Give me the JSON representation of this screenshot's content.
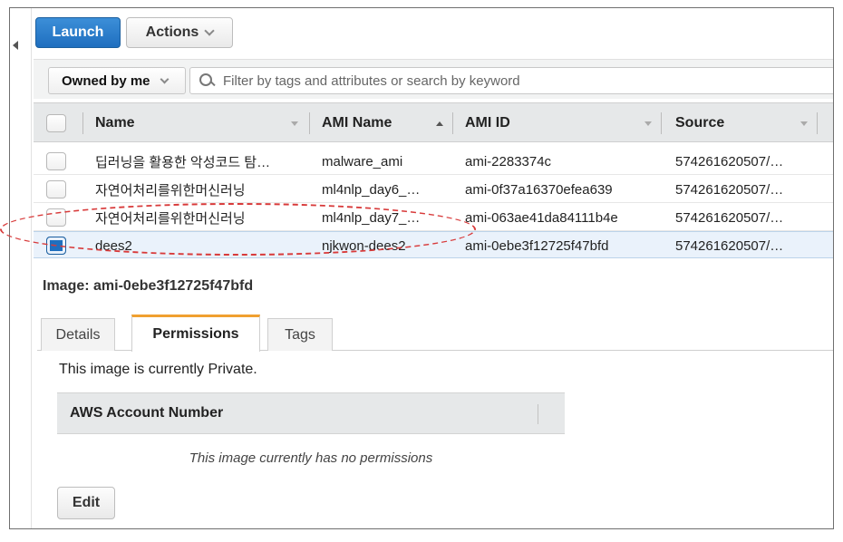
{
  "toolbar": {
    "launch_label": "Launch",
    "actions_label": "Actions"
  },
  "filter": {
    "owner_selected": "Owned by me",
    "search_placeholder": "Filter by tags and attributes or search by keyword"
  },
  "grid": {
    "columns": [
      "Name",
      "AMI Name",
      "AMI ID",
      "Source"
    ],
    "rows": [
      {
        "name": "딥러닝을 활용한 악성코드 탐…",
        "ami_name": "malware_ami",
        "ami_id": "ami-2283374c",
        "source": "574261620507/…",
        "selected": false
      },
      {
        "name": "자연어처리를위한머신러닝",
        "ami_name": "ml4nlp_day6_…",
        "ami_id": "ami-0f37a16370efea639",
        "source": "574261620507/…",
        "selected": false
      },
      {
        "name": "자연어처리를위한머신러닝",
        "ami_name": "ml4nlp_day7_…",
        "ami_id": "ami-063ae41da84111b4e",
        "source": "574261620507/…",
        "selected": false
      },
      {
        "name": "dees2",
        "ami_name": "njkwon-dees2",
        "ami_id": "ami-0ebe3f12725f47bfd",
        "source": "574261620507/…",
        "selected": true
      }
    ]
  },
  "detail": {
    "image_label": "Image: ami-0ebe3f12725f47bfd",
    "tabs": [
      {
        "label": "Details",
        "active": false
      },
      {
        "label": "Permissions",
        "active": true
      },
      {
        "label": "Tags",
        "active": false
      }
    ],
    "private_text": "This image is currently Private.",
    "account_header": "AWS Account Number",
    "no_permissions_text": "This image currently has no permissions",
    "edit_label": "Edit"
  },
  "colors": {
    "accent": "#1f6fbf",
    "active_tab": "#f0a030",
    "highlight_ellipse": "#d83a3a",
    "selected_row": "#eaf2fb"
  }
}
